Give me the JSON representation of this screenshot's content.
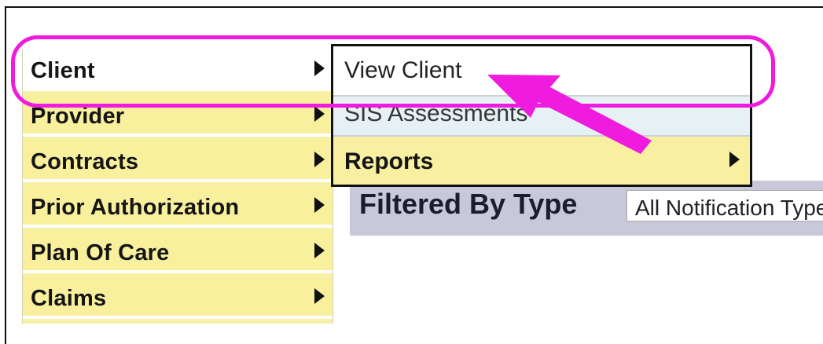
{
  "menu": {
    "items": [
      {
        "label": "Client"
      },
      {
        "label": "Provider"
      },
      {
        "label": "Contracts"
      },
      {
        "label": "Prior Authorization"
      },
      {
        "label": "Plan Of Care"
      },
      {
        "label": "Claims"
      }
    ]
  },
  "submenu": {
    "items": [
      {
        "label": "View Client"
      },
      {
        "label": "SIS Assessments"
      },
      {
        "label": "Reports"
      }
    ]
  },
  "filter": {
    "label": "Filtered By Type",
    "value": "All Notification Types"
  },
  "annotation": {
    "color": "#ef1bde"
  }
}
